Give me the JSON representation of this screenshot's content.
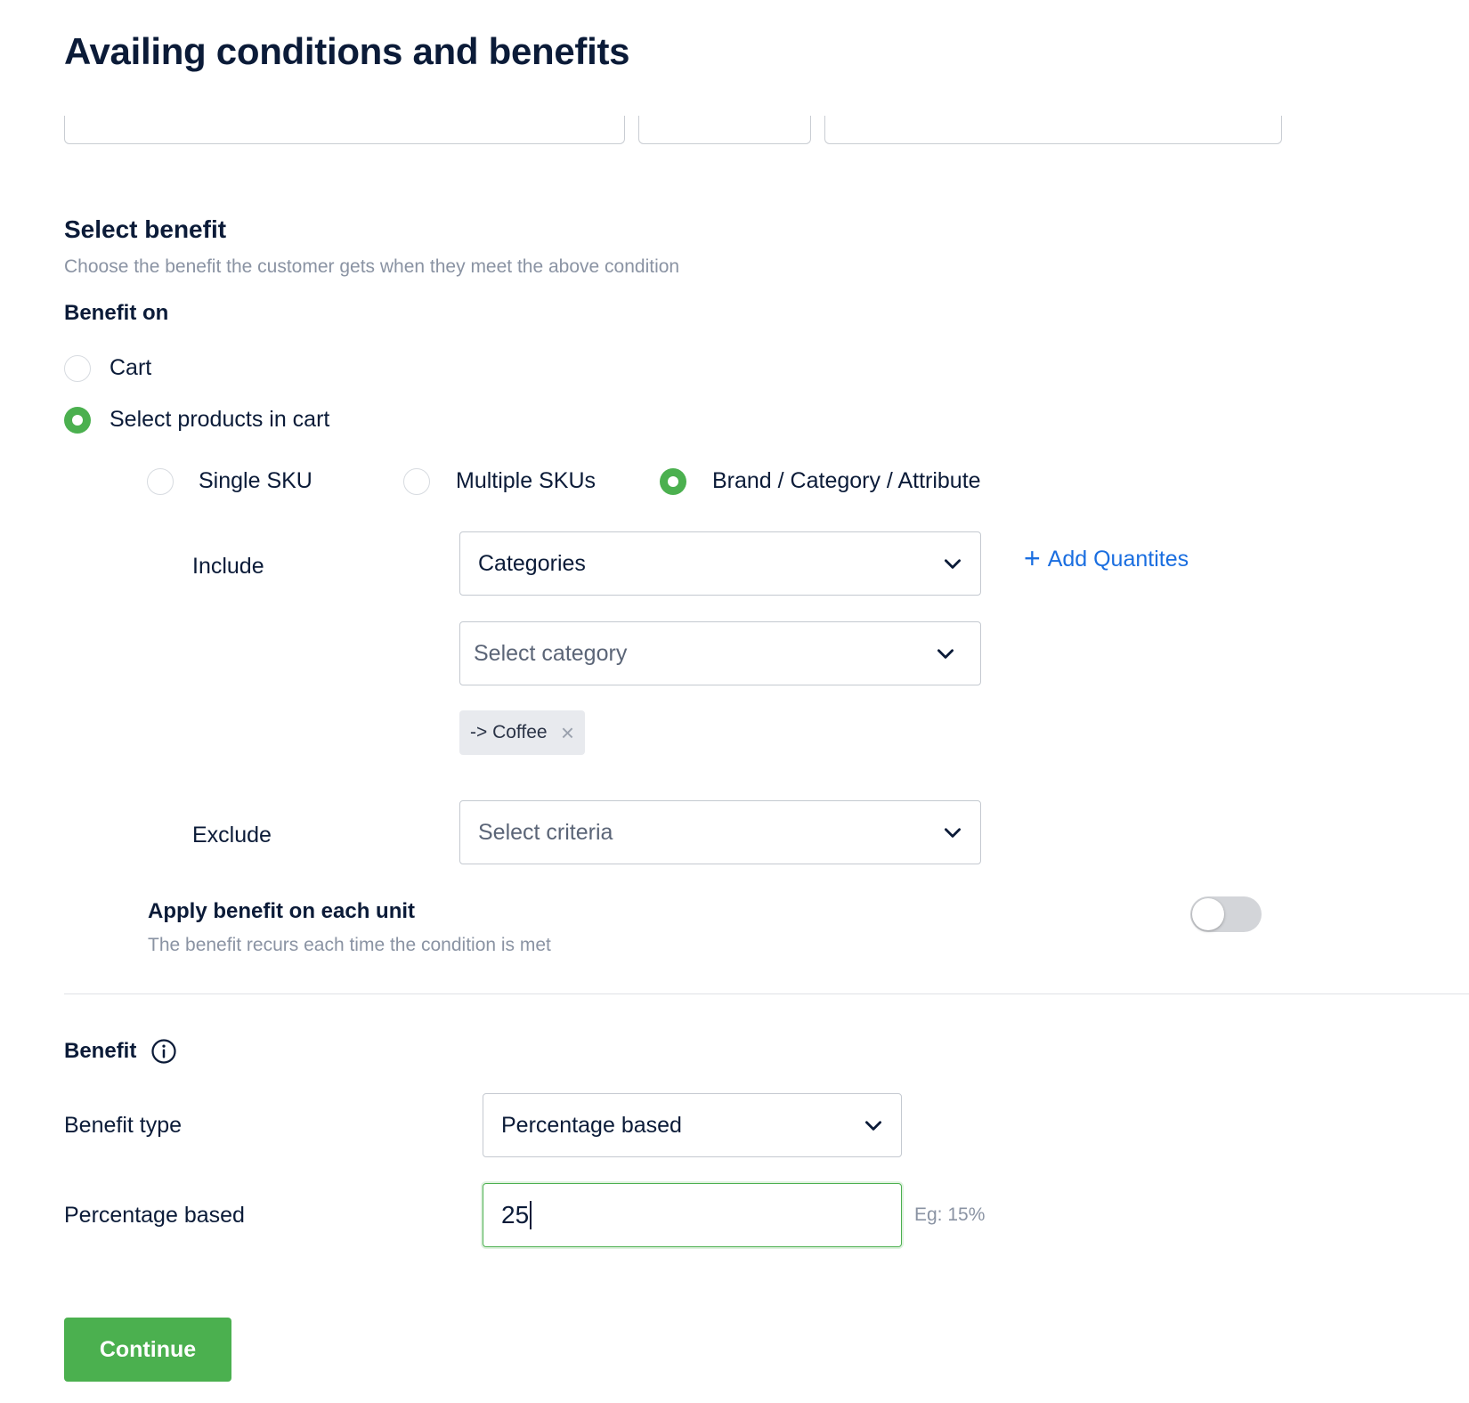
{
  "page_title": "Availing conditions and benefits",
  "select_benefit": {
    "title": "Select benefit",
    "subtitle": "Choose the benefit the customer gets when they meet the above condition",
    "benefit_on_label": "Benefit on",
    "benefit_on_options": [
      {
        "label": "Cart",
        "selected": false
      },
      {
        "label": "Select products in cart",
        "selected": true
      }
    ],
    "product_scope_options": [
      {
        "label": "Single SKU",
        "selected": false
      },
      {
        "label": "Multiple SKUs",
        "selected": false
      },
      {
        "label": "Brand / Category / Attribute",
        "selected": true
      }
    ],
    "include": {
      "label": "Include",
      "type_select": "Categories",
      "category_select_placeholder": "Select category",
      "add_quantities": "Add Quantites",
      "chips": [
        {
          "label": "-> Coffee"
        }
      ]
    },
    "exclude": {
      "label": "Exclude",
      "criteria_placeholder": "Select criteria"
    },
    "apply_each_unit": {
      "title": "Apply benefit on each unit",
      "subtitle": "The benefit recurs each time the condition is met",
      "enabled": false
    }
  },
  "benefit": {
    "title": "Benefit",
    "info_icon": "info-icon",
    "type_label": "Benefit type",
    "type_value": "Percentage based",
    "percentage_label": "Percentage based",
    "percentage_value": "25",
    "percentage_hint": "Eg: 15%"
  },
  "actions": {
    "continue": "Continue"
  },
  "colors": {
    "accent_green": "#4bb04f",
    "link_blue": "#1a6ee0",
    "heading_navy": "#0b1b38",
    "muted_gray": "#8a93a3"
  }
}
